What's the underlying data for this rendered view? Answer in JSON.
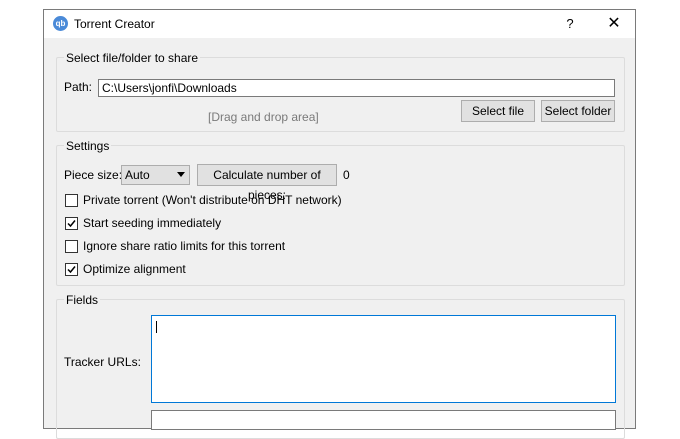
{
  "window": {
    "title": "Torrent Creator",
    "help": "?",
    "close": "✕",
    "icon_text": "qb"
  },
  "select_group": {
    "title": "Select file/folder to share",
    "path_label": "Path:",
    "path_value": "C:\\Users\\jonfi\\Downloads",
    "drop_text": "[Drag and drop area]",
    "select_file": "Select file",
    "select_folder": "Select folder"
  },
  "settings": {
    "title": "Settings",
    "piece_size_label": "Piece size:",
    "piece_size_value": "Auto",
    "calc_button": "Calculate number of pieces:",
    "pieces_count": "0",
    "options": [
      {
        "label": "Private torrent (Won't distribute on DHT network)",
        "checked": false
      },
      {
        "label": "Start seeding immediately",
        "checked": true
      },
      {
        "label": "Ignore share ratio limits for this torrent",
        "checked": false
      },
      {
        "label": "Optimize alignment",
        "checked": true
      }
    ]
  },
  "fields": {
    "title": "Fields",
    "tracker_urls_label": "Tracker URLs:",
    "tracker_urls_value": ""
  },
  "colors": {
    "accent": "#0078d7",
    "background": "#f0f0f0"
  }
}
